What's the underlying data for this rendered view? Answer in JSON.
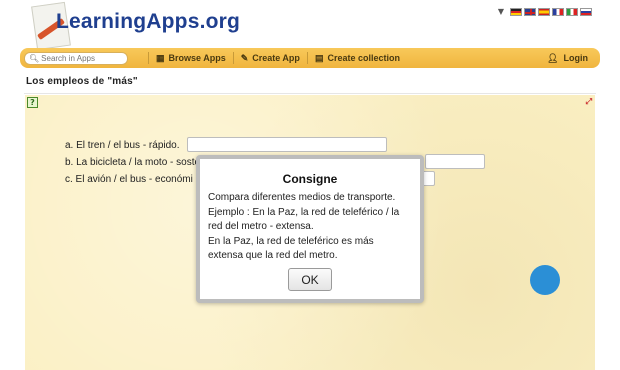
{
  "header": {
    "logo_text": "LearningApps.org",
    "languages": [
      "de",
      "en",
      "es",
      "fr",
      "it",
      "ru"
    ]
  },
  "navbar": {
    "search_placeholder": "Search in Apps",
    "items": [
      {
        "label": "Browse Apps",
        "icon": "grid-icon"
      },
      {
        "label": "Create App",
        "icon": "pencil-icon"
      },
      {
        "label": "Create collection",
        "icon": "collection-icon"
      }
    ],
    "login_label": "Login",
    "color": "#f0b53e"
  },
  "page": {
    "title": "Los empleos de \"más\""
  },
  "exercise": {
    "items": [
      {
        "label": "a. El tren / el bus - rápido."
      },
      {
        "label": "b. La bicicleta / la moto - sosten"
      },
      {
        "label": "c. El avión / el bus - económi"
      }
    ]
  },
  "modal": {
    "title": "Consigne",
    "lines": [
      "Compara diferentes medios de transporte.",
      "Ejemplo : En la Paz, la red de teleférico / la",
      "red del metro - extensa.",
      "En la Paz, la red de teleférico es más",
      "extensa que la red del metro."
    ],
    "ok_label": "OK"
  }
}
